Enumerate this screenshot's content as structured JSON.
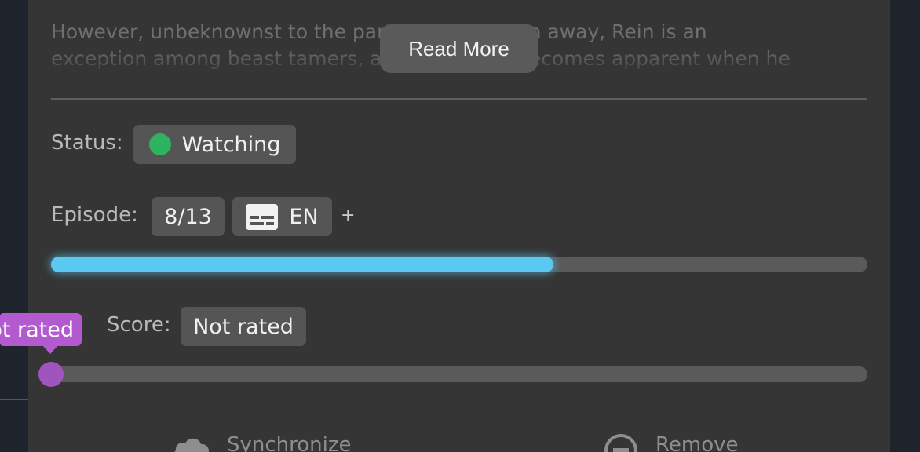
{
  "synopsis": {
    "line1": "However, unbeknownst to the party who cast him away, Rein is an",
    "line2": "exception among beast tamers, a fact that will becomes apparent when he",
    "read_more": "Read More"
  },
  "status": {
    "label": "Status:",
    "value": "Watching",
    "dot_color": "#2eb360"
  },
  "episode": {
    "label": "Episode:",
    "progress_text": "8/13",
    "watched": 8,
    "total": 13,
    "subtitle_icon": "subtitles-icon",
    "subtitle_lang": "EN",
    "plus": "+"
  },
  "score": {
    "label": "Score:",
    "value": "Not rated",
    "tooltip": "Not rated",
    "level": 0
  },
  "actions": {
    "sync_label": "Synchronize",
    "sync_icon": "cloud-icon",
    "remove_label": "Remove",
    "remove_icon": "remove-circle-icon"
  },
  "colors": {
    "progress": "#59c9f1",
    "score_accent": "#a054bd"
  }
}
